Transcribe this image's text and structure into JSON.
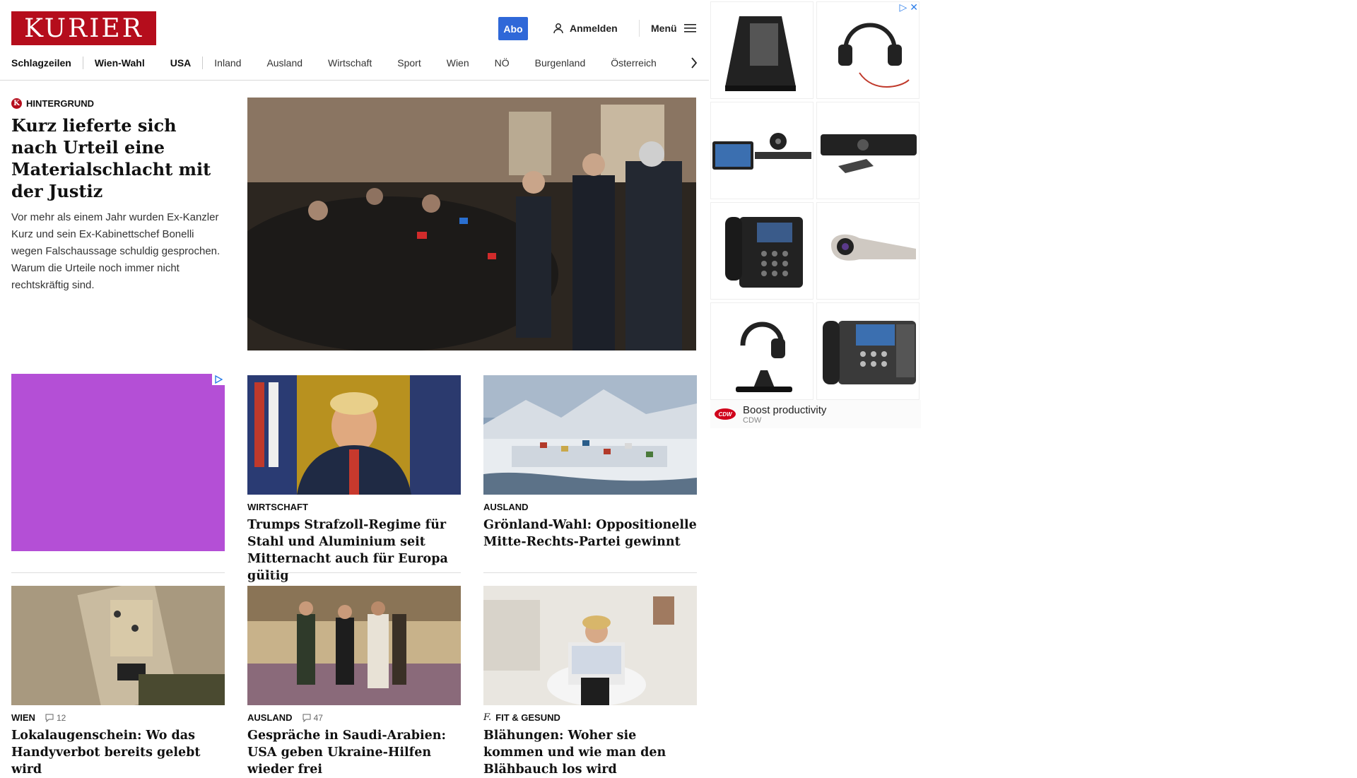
{
  "header": {
    "logo_text": "KURIER",
    "abo_label": "Abo",
    "login_label": "Anmelden",
    "menu_label": "Menü"
  },
  "nav": {
    "items": [
      "Schlagzeilen",
      "Wien-Wahl",
      "USA",
      "Inland",
      "Ausland",
      "Wirtschaft",
      "Sport",
      "Wien",
      "NÖ",
      "Burgenland",
      "Österreich"
    ]
  },
  "top_story": {
    "kicker": "HINTERGRUND",
    "kicker_badge": "K",
    "title": "Kurz lieferte sich nach Urteil eine Materialschlacht mit der Justiz",
    "summary": "Vor mehr als einem Jahr wurden Ex-Kanzler Kurz und sein Ex-Kabinettschef Bonelli wegen Falschaussage schuldig gesprochen. Warum die Urteile noch immer nicht rechtskräftig sind."
  },
  "cards": [
    {
      "category": "WIRTSCHAFT",
      "title": "Trumps Strafzoll-Regime für Stahl und Aluminium seit Mitternacht auch für Europa gültig",
      "comments": ""
    },
    {
      "category": "AUSLAND",
      "title": "Grönland-Wahl: Oppositionelle Mitte-Rechts-Partei gewinnt",
      "comments": ""
    },
    {
      "category": "WIEN",
      "title": "Lokalaugenschein: Wo das Handyverbot bereits gelebt wird",
      "comments": "12"
    },
    {
      "category": "AUSLAND",
      "title": "Gespräche in Saudi-Arabien: USA geben Ukraine-Hilfen wieder frei",
      "comments": "47"
    },
    {
      "category": "FIT & GESUND",
      "title": "Blähungen: Woher sie kommen und wie man den Blähbauch los wird",
      "comments": ""
    }
  ],
  "ad": {
    "headline": "Boost productivity",
    "advertiser": "CDW",
    "logo_text": "CDW"
  },
  "colors": {
    "brand_red": "#b50d1c",
    "abo_blue": "#2f68d8",
    "ad_purple": "#b44fd6"
  }
}
